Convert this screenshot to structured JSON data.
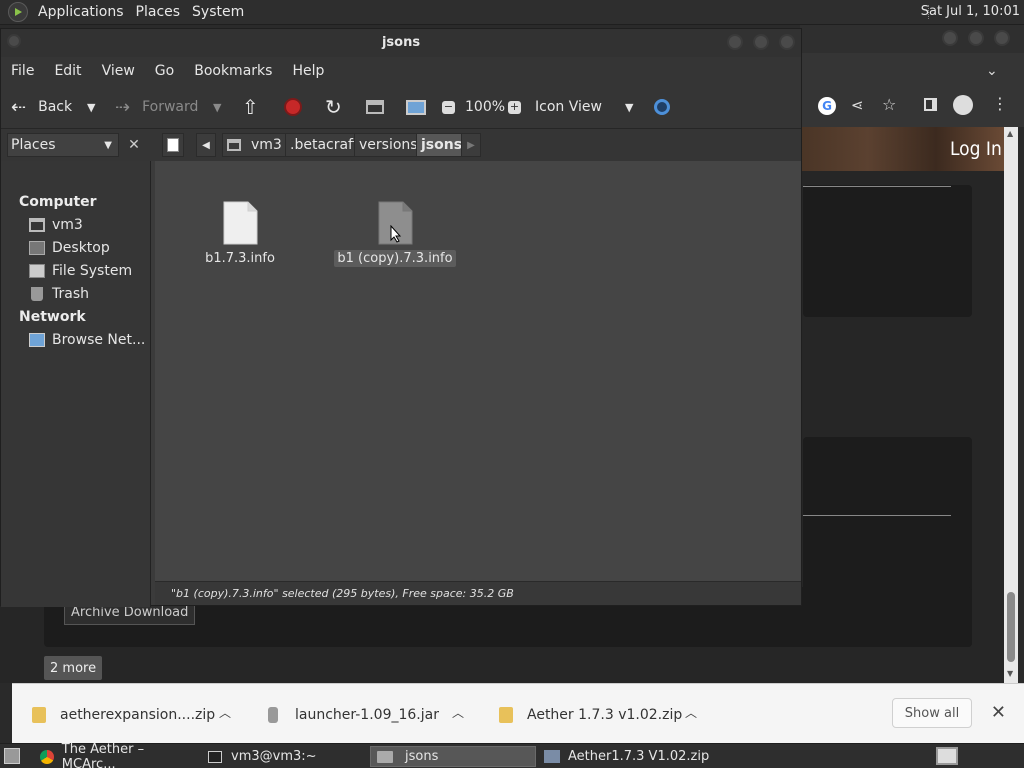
{
  "top_panel": {
    "menus": [
      "Applications",
      "Places",
      "System"
    ],
    "clock": "Sat Jul  1, 10:01"
  },
  "chrome": {
    "login": "Log In",
    "archive_download": "Archive Download",
    "more": "2 more"
  },
  "downloads": {
    "items": [
      {
        "name": "aetherexpansion....zip"
      },
      {
        "name": "launcher-1.09_16.jar"
      },
      {
        "name": "Aether 1.7.3 v1.02.zip"
      }
    ],
    "show_all": "Show all"
  },
  "file_manager": {
    "title": "jsons",
    "menus": [
      "File",
      "Edit",
      "View",
      "Go",
      "Bookmarks",
      "Help"
    ],
    "toolbar": {
      "back": "Back",
      "forward": "Forward",
      "zoom": "100%",
      "view_mode": "Icon View"
    },
    "places_select": "Places",
    "breadcrumbs": [
      "vm3",
      ".betacraft",
      "versions",
      "jsons"
    ],
    "sidebar": {
      "computer_header": "Computer",
      "computer_items": [
        "vm3",
        "Desktop",
        "File System",
        "Trash"
      ],
      "network_header": "Network",
      "network_items": [
        "Browse Net..."
      ]
    },
    "files": [
      {
        "name": "b1.7.3.info",
        "selected": false
      },
      {
        "name": "b1 (copy).7.3.info",
        "selected": true
      }
    ],
    "status": "\"b1 (copy).7.3.info\" selected (295 bytes), Free space: 35.2 GB"
  },
  "taskbar": {
    "tasks": [
      {
        "label": "The Aether – MCArc..."
      },
      {
        "label": "vm3@vm3:~"
      },
      {
        "label": "jsons"
      },
      {
        "label": "Aether1.7.3 V1.02.zip"
      }
    ]
  }
}
